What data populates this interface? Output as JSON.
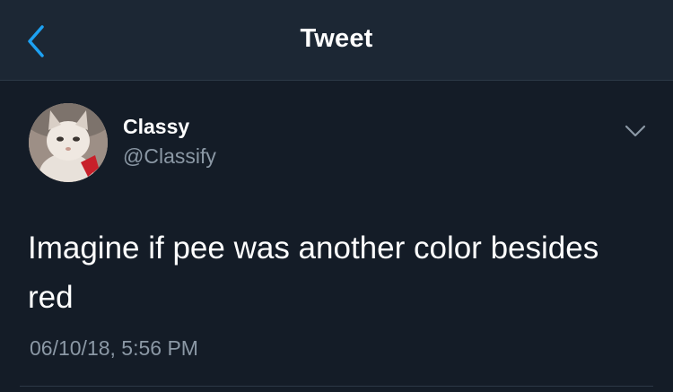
{
  "nav": {
    "title": "Tweet",
    "back_icon": "chevron-left-icon"
  },
  "tweet": {
    "author": {
      "display_name": "Classy",
      "handle": "@Classify",
      "avatar": "cat-avatar"
    },
    "text": "Imagine if pee was another color besides red",
    "timestamp": "06/10/18, 5:56 PM",
    "menu_icon": "chevron-down-icon"
  },
  "colors": {
    "background": "#141c27",
    "nav_background": "#1c2734",
    "accent": "#1da1f2",
    "secondary_text": "#8b98a5",
    "primary_text": "#ffffff"
  }
}
